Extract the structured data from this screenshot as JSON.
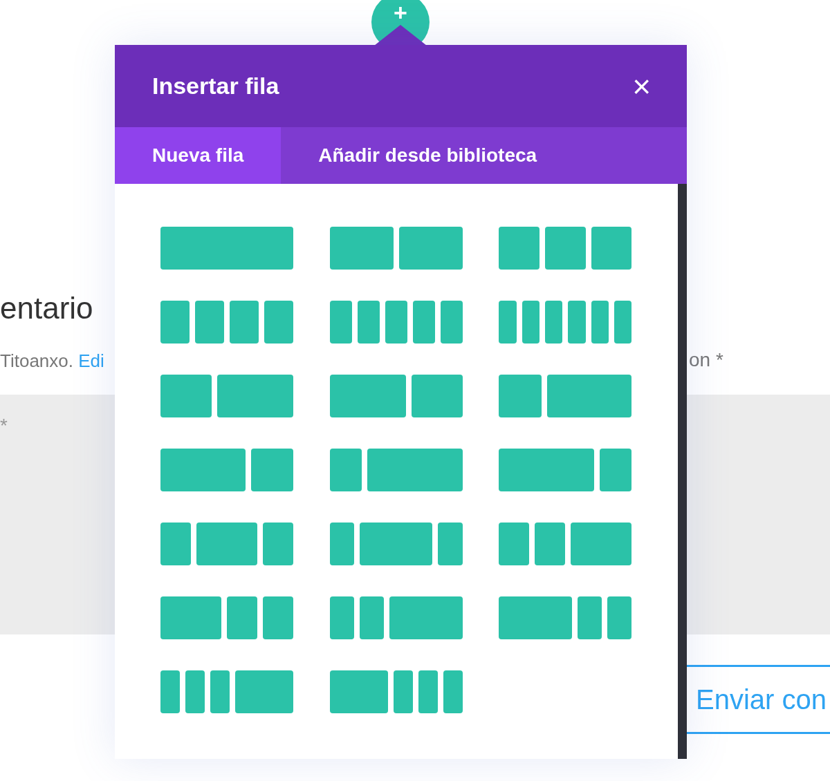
{
  "page": {
    "heading": "entario",
    "logged_in_text": "Titoanxo.",
    "edit_link": "Edi",
    "field_label": "on *",
    "textarea_mark": "*",
    "submit_button": "Enviar con"
  },
  "add_button": {
    "label": "+"
  },
  "modal": {
    "title": "Insertar fila",
    "close": "×",
    "tabs": [
      {
        "label": "Nueva fila",
        "selected": true
      },
      {
        "label": "Añadir desde biblioteca",
        "selected": false
      }
    ],
    "layouts": [
      {
        "kind": "full"
      },
      {
        "kind": "halves"
      },
      {
        "kind": "thirds"
      },
      {
        "kind": "quarters"
      },
      {
        "kind": "fifths"
      },
      {
        "kind": "sixths"
      },
      {
        "kind": "twofifthsfirst"
      },
      {
        "kind": "threefifthsfirst"
      },
      {
        "kind": "thirdfirst"
      },
      {
        "kind": "twothirdsfirst"
      },
      {
        "kind": "quarterfirst"
      },
      {
        "kind": "threequartersfirst"
      },
      {
        "kind": "halfcentered"
      },
      {
        "kind": "threefifthscentered"
      },
      {
        "kind": "halflast"
      },
      {
        "kind": "halffirst"
      },
      {
        "kind": "threefifthslast"
      },
      {
        "kind": "threefifthsleading"
      },
      {
        "kind": "sixthsthenhalf"
      },
      {
        "kind": "halfthensixths"
      }
    ]
  }
}
